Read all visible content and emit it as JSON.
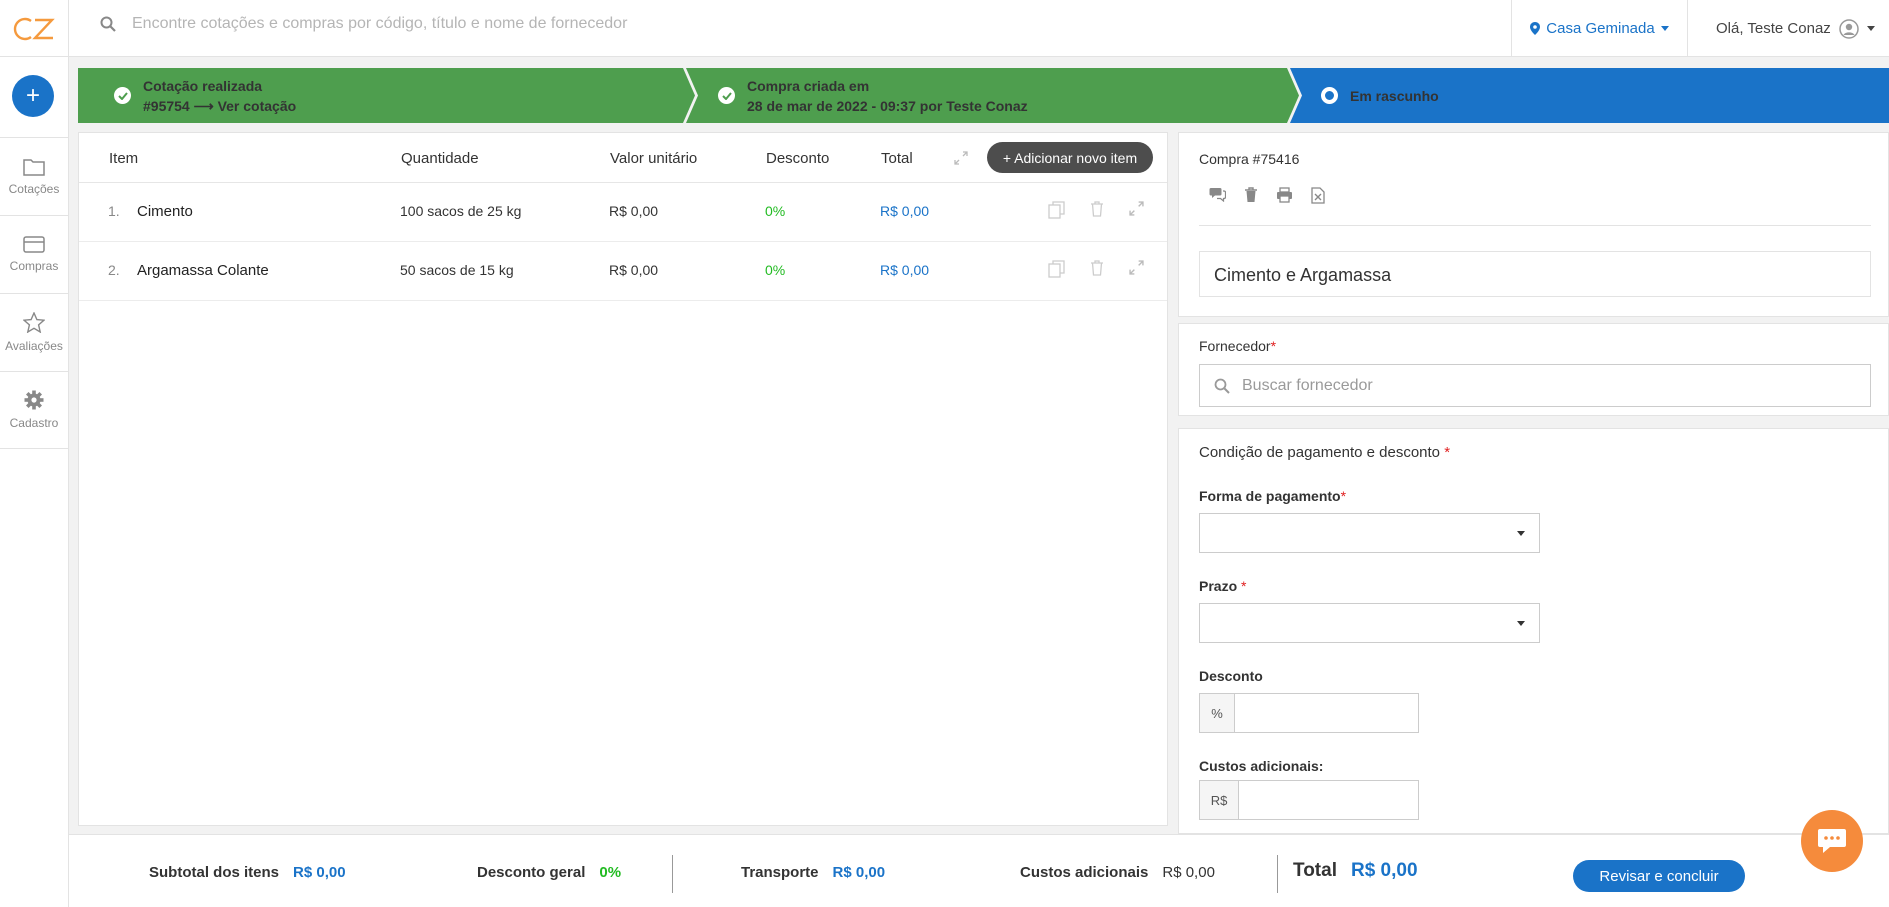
{
  "colors": {
    "accent": "#1a73c8",
    "done": "#4e9e4e",
    "current": "#1a73c8",
    "logo_orange": "#f59a3e",
    "chat": "#f58b3c"
  },
  "topbar": {
    "logo": "CZ",
    "search_placeholder": "Encontre cotações e compras por código, título e nome de fornecedor",
    "location": "Casa Geminada",
    "greeting": "Olá, Teste Conaz"
  },
  "sidebar": {
    "new_label": "+",
    "items": [
      {
        "label": "Cotações",
        "icon": "folder-icon"
      },
      {
        "label": "Compras",
        "icon": "card-icon"
      },
      {
        "label": "Avaliações",
        "icon": "star-icon"
      },
      {
        "label": "Cadastro",
        "icon": "gear-icon"
      }
    ]
  },
  "stepper": [
    {
      "line1": "Cotação realizada",
      "line2": "#95754 ⟶ Ver cotação",
      "status": "done"
    },
    {
      "line1": "Compra criada em",
      "line2": "28 de mar de 2022 - 09:37 por Teste Conaz",
      "status": "done"
    },
    {
      "line1": "Em rascunho",
      "status": "current"
    }
  ],
  "items_table": {
    "headers": {
      "item": "Item",
      "quantity": "Quantidade",
      "unit_price": "Valor unitário",
      "discount": "Desconto",
      "total": "Total"
    },
    "add_button": "+ Adicionar novo item",
    "rows": [
      {
        "num": "1.",
        "name": "Cimento",
        "quantity": "100 sacos de 25 kg",
        "unit_price": "R$ 0,00",
        "discount": "0%",
        "total": "R$ 0,00"
      },
      {
        "num": "2.",
        "name": "Argamassa Colante",
        "quantity": "50 sacos de 15 kg",
        "unit_price": "R$ 0,00",
        "discount": "0%",
        "total": "R$ 0,00"
      }
    ]
  },
  "purchase": {
    "id": "Compra #75416",
    "title": "Cimento e Argamassa"
  },
  "supplier": {
    "label": "Fornecedor",
    "placeholder": "Buscar fornecedor"
  },
  "payment": {
    "section_title": "Condição de pagamento e desconto",
    "method_label": "Forma de pagamento",
    "term_label": "Prazo",
    "discount_label": "Desconto",
    "discount_prefix": "%",
    "extra_costs_label": "Custos adicionais:",
    "extra_costs_prefix": "R$"
  },
  "footer": {
    "subtotal_label": "Subtotal dos itens",
    "subtotal_value": "R$ 0,00",
    "discount_label": "Desconto geral",
    "discount_value": "0%",
    "transport_label": "Transporte",
    "transport_value": "R$ 0,00",
    "extra_label": "Custos adicionais",
    "extra_value": "R$ 0,00",
    "total_label": "Total",
    "total_value": "R$ 0,00",
    "review_button": "Revisar e concluir"
  }
}
